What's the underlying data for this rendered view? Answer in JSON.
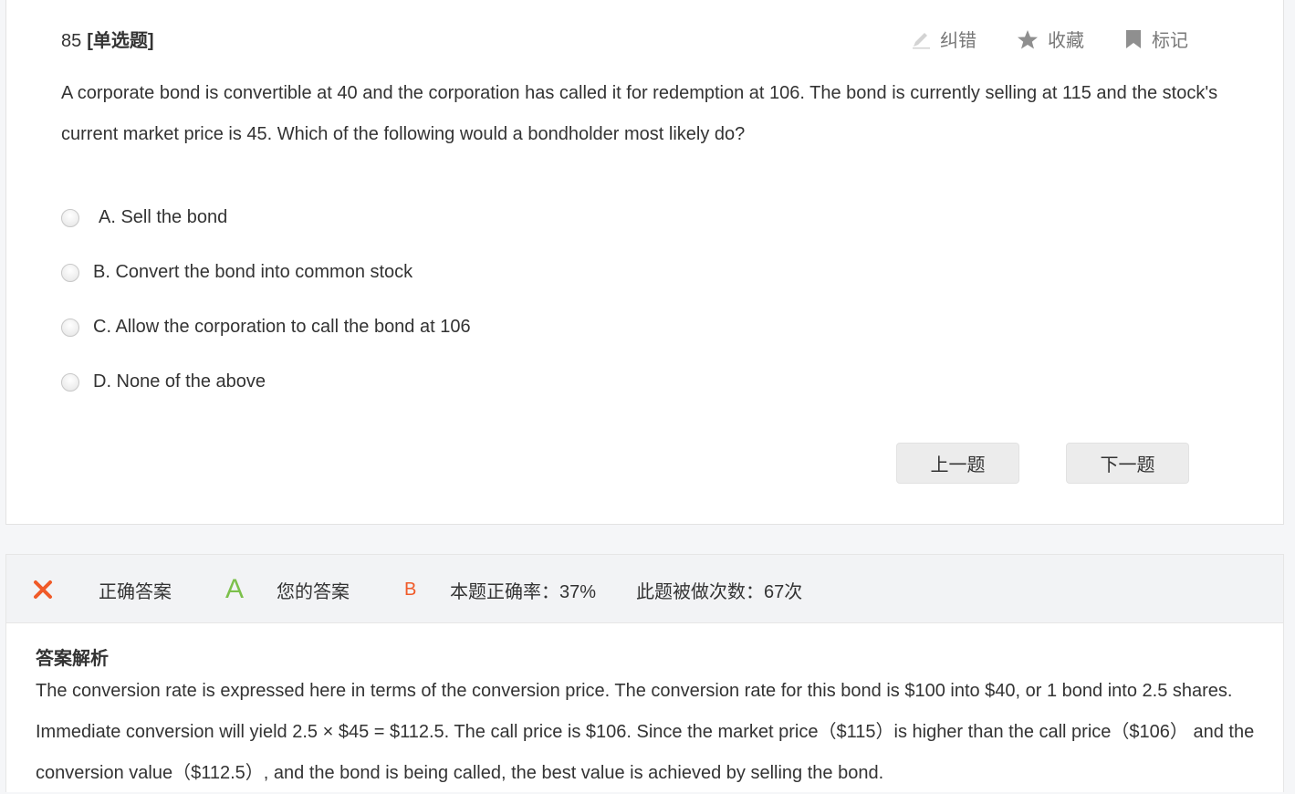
{
  "question": {
    "number": "85",
    "type": "[单选题]",
    "stem": "A corporate bond is convertible at 40 and the corporation has called it for redemption at 106. The bond is currently selling at 115 and the stock's current market price is 45. Which of the following would a bondholder most likely do?",
    "options": [
      {
        "label": "A. Sell the bond"
      },
      {
        "label": "B. Convert the bond into common stock"
      },
      {
        "label": "C. Allow the corporation to call the bond at 106"
      },
      {
        "label": "D. None of the above"
      }
    ]
  },
  "actions": {
    "correct_label": "纠错",
    "favorite_label": "收藏",
    "mark_label": "标记"
  },
  "navigation": {
    "prev_label": "上一题",
    "next_label": "下一题"
  },
  "result": {
    "status_icon": "x-icon",
    "correct_answer_label": "正确答案",
    "correct_answer": "A",
    "your_answer_label": "您的答案",
    "your_answer": "B",
    "accuracy_text": "本题正确率：37%",
    "attempts_text": "此题被做次数：67次",
    "colors": {
      "wrong": "#f05a28",
      "correct": "#7cc04b",
      "your": "#f05a28"
    }
  },
  "analysis": {
    "title": "答案解析",
    "text": "The conversion rate is expressed here in terms of the conversion price. The conversion rate for this bond is $100 into $40, or 1 bond into 2.5 shares. Immediate conversion will yield 2.5 × $45 = $112.5. The call price is $106. Since the market price（$115）is higher than the call price（$106） and the conversion value（$112.5）, and the bond is being called, the best value is achieved by selling the bond."
  }
}
